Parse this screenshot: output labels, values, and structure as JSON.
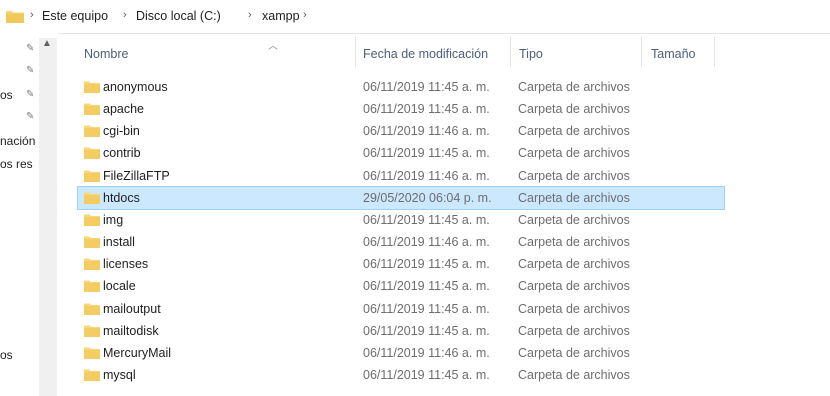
{
  "breadcrumb": {
    "items": [
      "Este equipo",
      "Disco local (C:)",
      "xampp"
    ],
    "separator": "›"
  },
  "nav": {
    "labels": [
      "os",
      "nación",
      "os res",
      "os"
    ]
  },
  "columns": {
    "name": "Nombre",
    "date": "Fecha de modificación",
    "type": "Tipo",
    "size": "Tamaño"
  },
  "colors": {
    "folder": "#f8d775",
    "selected_bg": "#cce8ff",
    "selected_border": "#99d1ff"
  },
  "rows": [
    {
      "name": "anonymous",
      "date": "06/11/2019 11:45 a. m.",
      "type": "Carpeta de archivos"
    },
    {
      "name": "apache",
      "date": "06/11/2019 11:45 a. m.",
      "type": "Carpeta de archivos"
    },
    {
      "name": "cgi-bin",
      "date": "06/11/2019 11:46 a. m.",
      "type": "Carpeta de archivos"
    },
    {
      "name": "contrib",
      "date": "06/11/2019 11:45 a. m.",
      "type": "Carpeta de archivos"
    },
    {
      "name": "FileZillaFTP",
      "date": "06/11/2019 11:46 a. m.",
      "type": "Carpeta de archivos"
    },
    {
      "name": "htdocs",
      "date": "29/05/2020 06:04 p. m.",
      "type": "Carpeta de archivos",
      "selected": true
    },
    {
      "name": "img",
      "date": "06/11/2019 11:45 a. m.",
      "type": "Carpeta de archivos"
    },
    {
      "name": "install",
      "date": "06/11/2019 11:46 a. m.",
      "type": "Carpeta de archivos"
    },
    {
      "name": "licenses",
      "date": "06/11/2019 11:45 a. m.",
      "type": "Carpeta de archivos"
    },
    {
      "name": "locale",
      "date": "06/11/2019 11:45 a. m.",
      "type": "Carpeta de archivos"
    },
    {
      "name": "mailoutput",
      "date": "06/11/2019 11:45 a. m.",
      "type": "Carpeta de archivos"
    },
    {
      "name": "mailtodisk",
      "date": "06/11/2019 11:45 a. m.",
      "type": "Carpeta de archivos"
    },
    {
      "name": "MercuryMail",
      "date": "06/11/2019 11:46 a. m.",
      "type": "Carpeta de archivos"
    },
    {
      "name": "mysql",
      "date": "06/11/2019 11:45 a. m.",
      "type": "Carpeta de archivos"
    }
  ]
}
